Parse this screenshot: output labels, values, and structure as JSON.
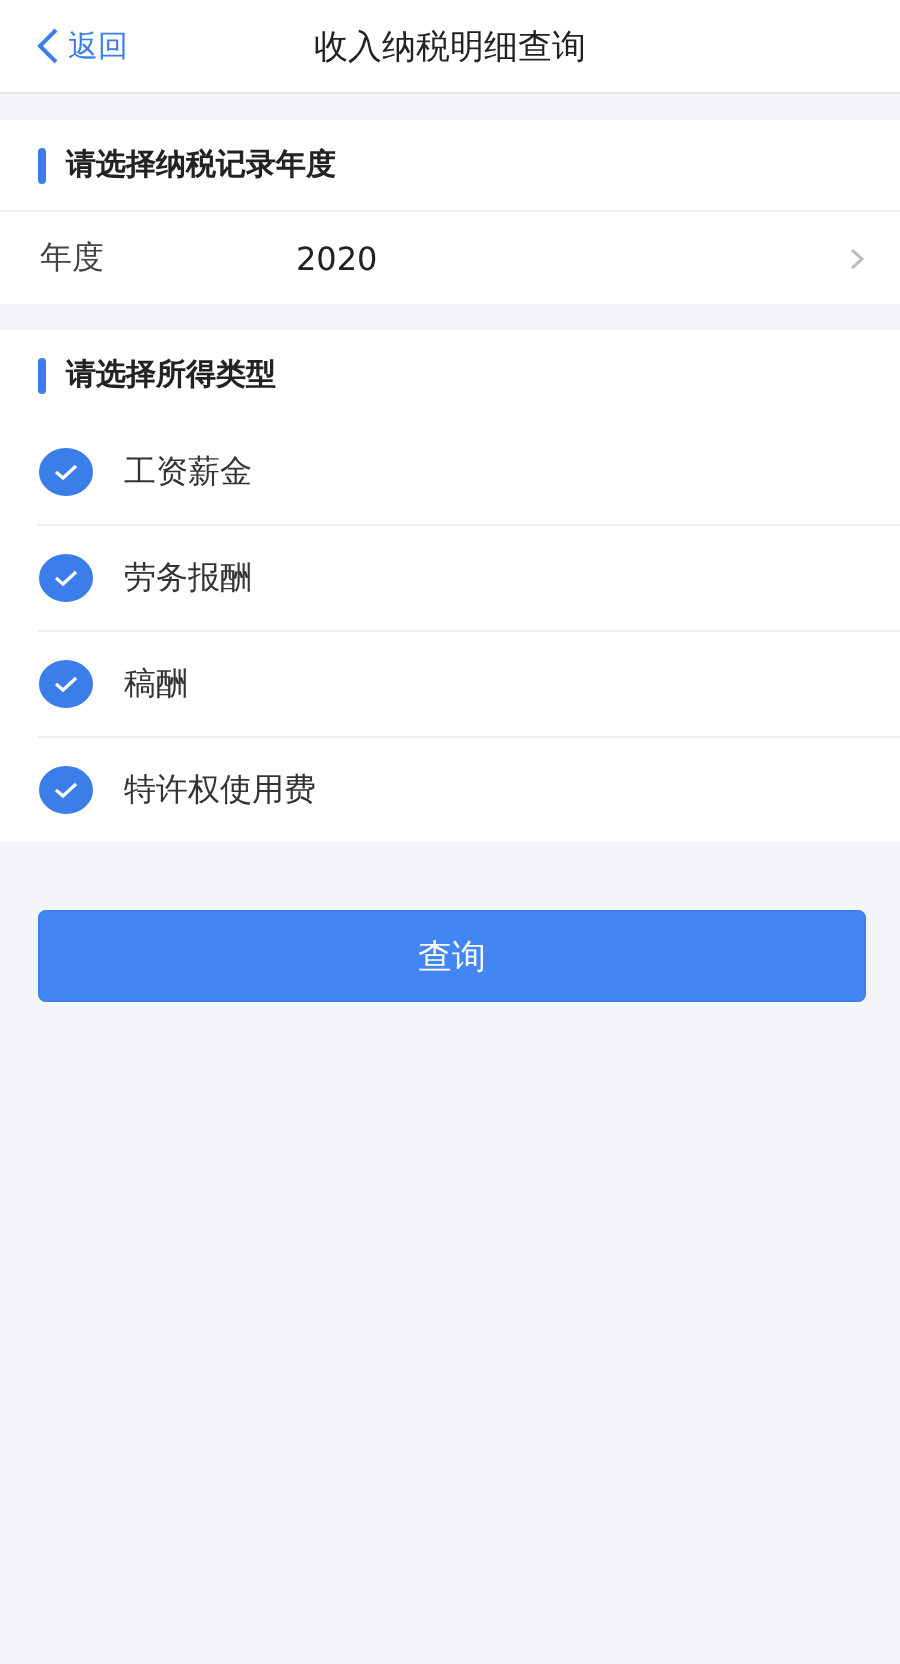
{
  "nav": {
    "back": "返回",
    "title": "收入纳税明细查询"
  },
  "year_section": {
    "heading": "请选择纳税记录年度",
    "label": "年度",
    "value": "2020"
  },
  "type_section": {
    "heading": "请选择所得类型",
    "options": [
      {
        "label": "工资薪金",
        "checked": true
      },
      {
        "label": "劳务报酬",
        "checked": true
      },
      {
        "label": "稿酬",
        "checked": true
      },
      {
        "label": "特许权使用费",
        "checked": true
      }
    ]
  },
  "submit": "查询"
}
